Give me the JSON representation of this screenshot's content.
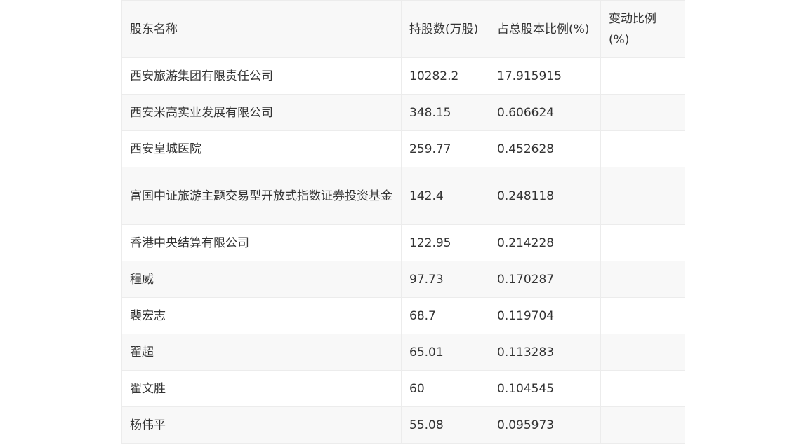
{
  "table": {
    "headers": [
      "股东名称",
      "持股数(万股)",
      "占总股本比例(%)",
      "变动比例(%)"
    ],
    "rows": [
      {
        "name": "西安旅游集团有限责任公司",
        "shares": "10282.2",
        "ratio": "17.915915",
        "change": ""
      },
      {
        "name": "西安米高实业发展有限公司",
        "shares": "348.15",
        "ratio": "0.606624",
        "change": ""
      },
      {
        "name": "西安皇城医院",
        "shares": "259.77",
        "ratio": "0.452628",
        "change": ""
      },
      {
        "name": "富国中证旅游主题交易型开放式指数证券投资基金",
        "shares": "142.4",
        "ratio": "0.248118",
        "change": ""
      },
      {
        "name": "香港中央结算有限公司",
        "shares": "122.95",
        "ratio": "0.214228",
        "change": ""
      },
      {
        "name": "程威",
        "shares": "97.73",
        "ratio": "0.170287",
        "change": ""
      },
      {
        "name": "裴宏志",
        "shares": "68.7",
        "ratio": "0.119704",
        "change": ""
      },
      {
        "name": "翟超",
        "shares": "65.01",
        "ratio": "0.113283",
        "change": ""
      },
      {
        "name": "翟文胜",
        "shares": "60",
        "ratio": "0.104545",
        "change": ""
      },
      {
        "name": "杨伟平",
        "shares": "55.08",
        "ratio": "0.095973",
        "change": ""
      }
    ]
  }
}
